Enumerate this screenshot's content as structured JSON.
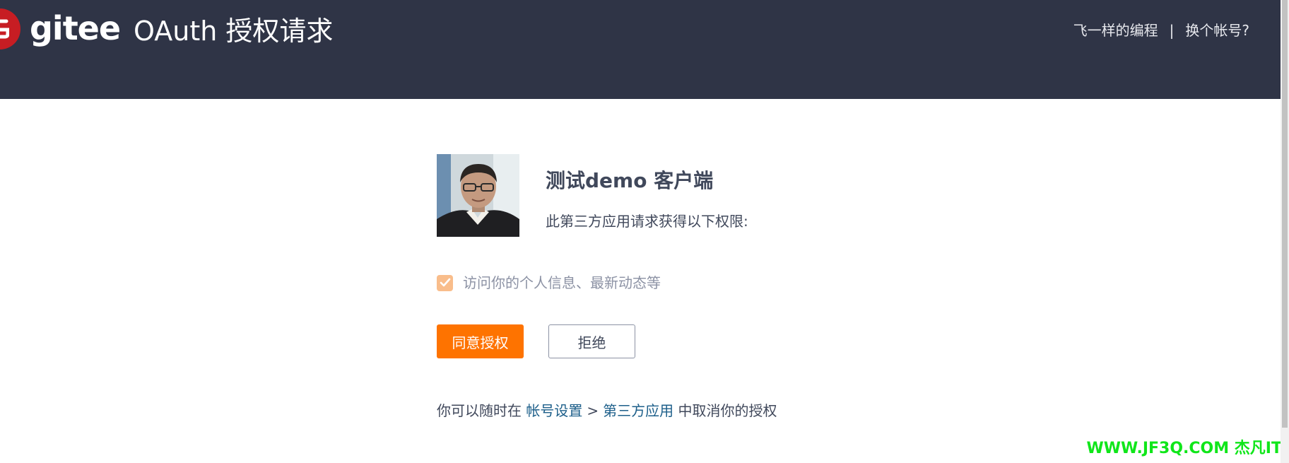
{
  "header": {
    "brand": "gitee",
    "title": "OAuth 授权请求",
    "username": "飞一样的编程",
    "separator": "|",
    "switch_account": "换个帐号?"
  },
  "app": {
    "name": "测试demo 客户端",
    "description": "此第三方应用请求获得以下权限:"
  },
  "permissions": [
    {
      "label": "访问你的个人信息、最新动态等",
      "checked": true
    }
  ],
  "buttons": {
    "agree": "同意授权",
    "reject": "拒绝"
  },
  "footer": {
    "prefix": "你可以随时在 ",
    "account_settings": "帐号设置",
    "arrow": ">",
    "third_party_apps": "第三方应用",
    "suffix": " 中取消你的授权"
  },
  "watermark": "WWW.JF3Q.COM 杰凡IT",
  "colors": {
    "header_bg": "#2f3446",
    "brand_red": "#c71d23",
    "accent_orange": "#fe7300",
    "link_blue": "#1d5f8a",
    "watermark_green": "#10e61a"
  },
  "icons": {
    "logo": "gitee-logo-icon",
    "checkbox": "check-icon"
  }
}
